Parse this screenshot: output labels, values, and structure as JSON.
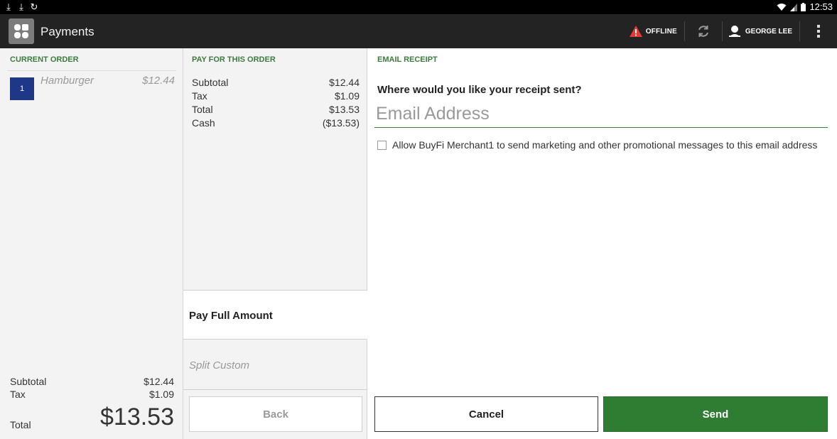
{
  "status_bar": {
    "left_icons": [
      "download-icon",
      "download-icon",
      "sync-icon"
    ],
    "time": "12:53"
  },
  "action_bar": {
    "title": "Payments",
    "offline_label": "OFFLINE",
    "user_name": "GEORGE LEE",
    "accent_warning": "#e53935"
  },
  "current_order": {
    "header": "CURRENT ORDER",
    "items": [
      {
        "qty": "1",
        "name": "Hamburger",
        "price": "$12.44"
      }
    ],
    "subtotal_label": "Subtotal",
    "subtotal_value": "$12.44",
    "tax_label": "Tax",
    "tax_value": "$1.09",
    "total_label": "Total",
    "total_value": "$13.53"
  },
  "pay_for_order": {
    "header": "PAY FOR THIS ORDER",
    "lines": [
      {
        "label": "Subtotal",
        "value": "$12.44"
      },
      {
        "label": "Tax",
        "value": "$1.09"
      },
      {
        "label": "Total",
        "value": "$13.53"
      },
      {
        "label": "Cash",
        "value": "($13.53)"
      }
    ],
    "pay_full_label": "Pay Full Amount",
    "split_custom_label": "Split Custom",
    "back_label": "Back"
  },
  "email_receipt": {
    "header": "EMAIL RECEIPT",
    "prompt": "Where would you like your receipt sent?",
    "email_placeholder": "Email Address",
    "email_value": "",
    "consent_label": "Allow BuyFi Merchant1 to send marketing and other promotional messages to this email address",
    "consent_checked": false,
    "cancel_label": "Cancel",
    "send_label": "Send",
    "accent_color": "#2e7d32"
  }
}
